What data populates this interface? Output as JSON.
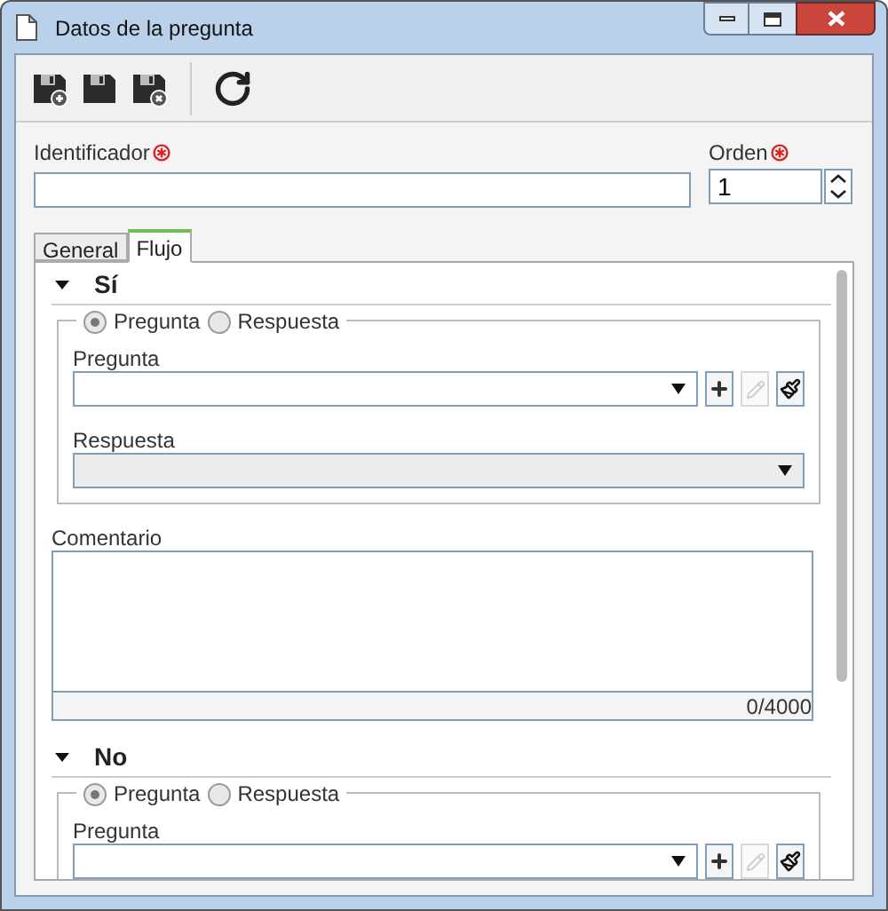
{
  "window": {
    "title": "Datos de la pregunta"
  },
  "toolbar": [
    {
      "kind": "save-new"
    },
    {
      "kind": "save"
    },
    {
      "kind": "save-close"
    },
    {
      "kind": "separator"
    },
    {
      "kind": "refresh"
    }
  ],
  "fields": {
    "identifier": {
      "label": "Identificador",
      "required": true
    },
    "order": {
      "label": "Orden",
      "required": true,
      "value": "1"
    }
  },
  "tabs": [
    {
      "label": "General",
      "selected": false
    },
    {
      "label": "Flujo",
      "selected": true
    }
  ],
  "sections": [
    {
      "title": "Sí",
      "expanded": true,
      "radios": [
        {
          "label": "Pregunta",
          "selected": true
        },
        {
          "label": "Respuesta",
          "selected": false
        }
      ],
      "question_label": "Pregunta",
      "answer_label": "Respuesta",
      "answer_disabled": true,
      "comment_label": "Comentario",
      "comment_counter": "0/4000"
    },
    {
      "title": "No",
      "expanded": true,
      "radios": [
        {
          "label": "Pregunta",
          "selected": true
        },
        {
          "label": "Respuesta",
          "selected": false
        }
      ],
      "question_label": "Pregunta"
    }
  ]
}
